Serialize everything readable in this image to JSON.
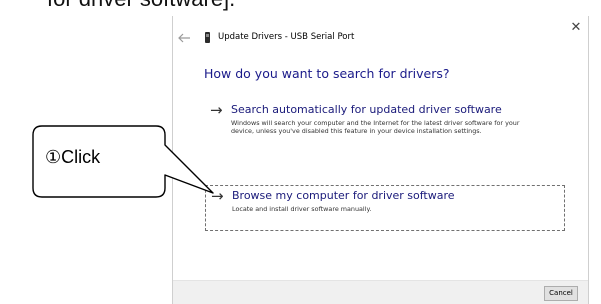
{
  "document": {
    "heading_fragment": "for driver software]."
  },
  "dialog": {
    "title": "Update Drivers - USB Serial Port",
    "close_glyph": "✕",
    "question": "How do you want to search for drivers?",
    "options": [
      {
        "arrow": "→",
        "title": "Search automatically for updated driver software",
        "description": "Windows will search your computer and the Internet for the latest driver software for your device, unless you've disabled this feature in your device installation settings."
      },
      {
        "arrow": "→",
        "title": "Browse my computer for driver software",
        "description": "Locate and install driver software manually."
      }
    ],
    "cancel_label": "Cancel"
  },
  "callout": {
    "label": "①Click"
  },
  "colors": {
    "link_blue": "#1a1a8a",
    "footer_gray": "#f0f0f0"
  }
}
